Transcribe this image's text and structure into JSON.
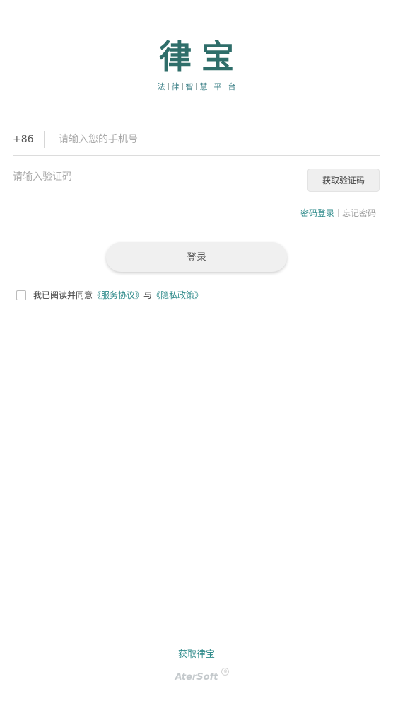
{
  "logo": {
    "title": "律宝",
    "subtitle_chars": [
      "法",
      "律",
      "智",
      "慧",
      "平",
      "台"
    ]
  },
  "phone": {
    "country_code": "+86",
    "placeholder": "请输入您的手机号",
    "value": ""
  },
  "code": {
    "placeholder": "请输入验证码",
    "value": "",
    "get_code_label": "获取验证码"
  },
  "links": {
    "password_login": "密码登录",
    "forgot_password": "忘记密码"
  },
  "login_button": "登录",
  "agreement": {
    "prefix": "我已阅读并同意",
    "service": "《服务协议》",
    "and": "与",
    "privacy": "《隐私政策》",
    "checked": false
  },
  "footer": {
    "get_app": "获取律宝",
    "brand": "AterSoft",
    "reg_mark": "®"
  },
  "colors": {
    "accent": "#2f8b8b",
    "logo": "#2f6e6a"
  }
}
